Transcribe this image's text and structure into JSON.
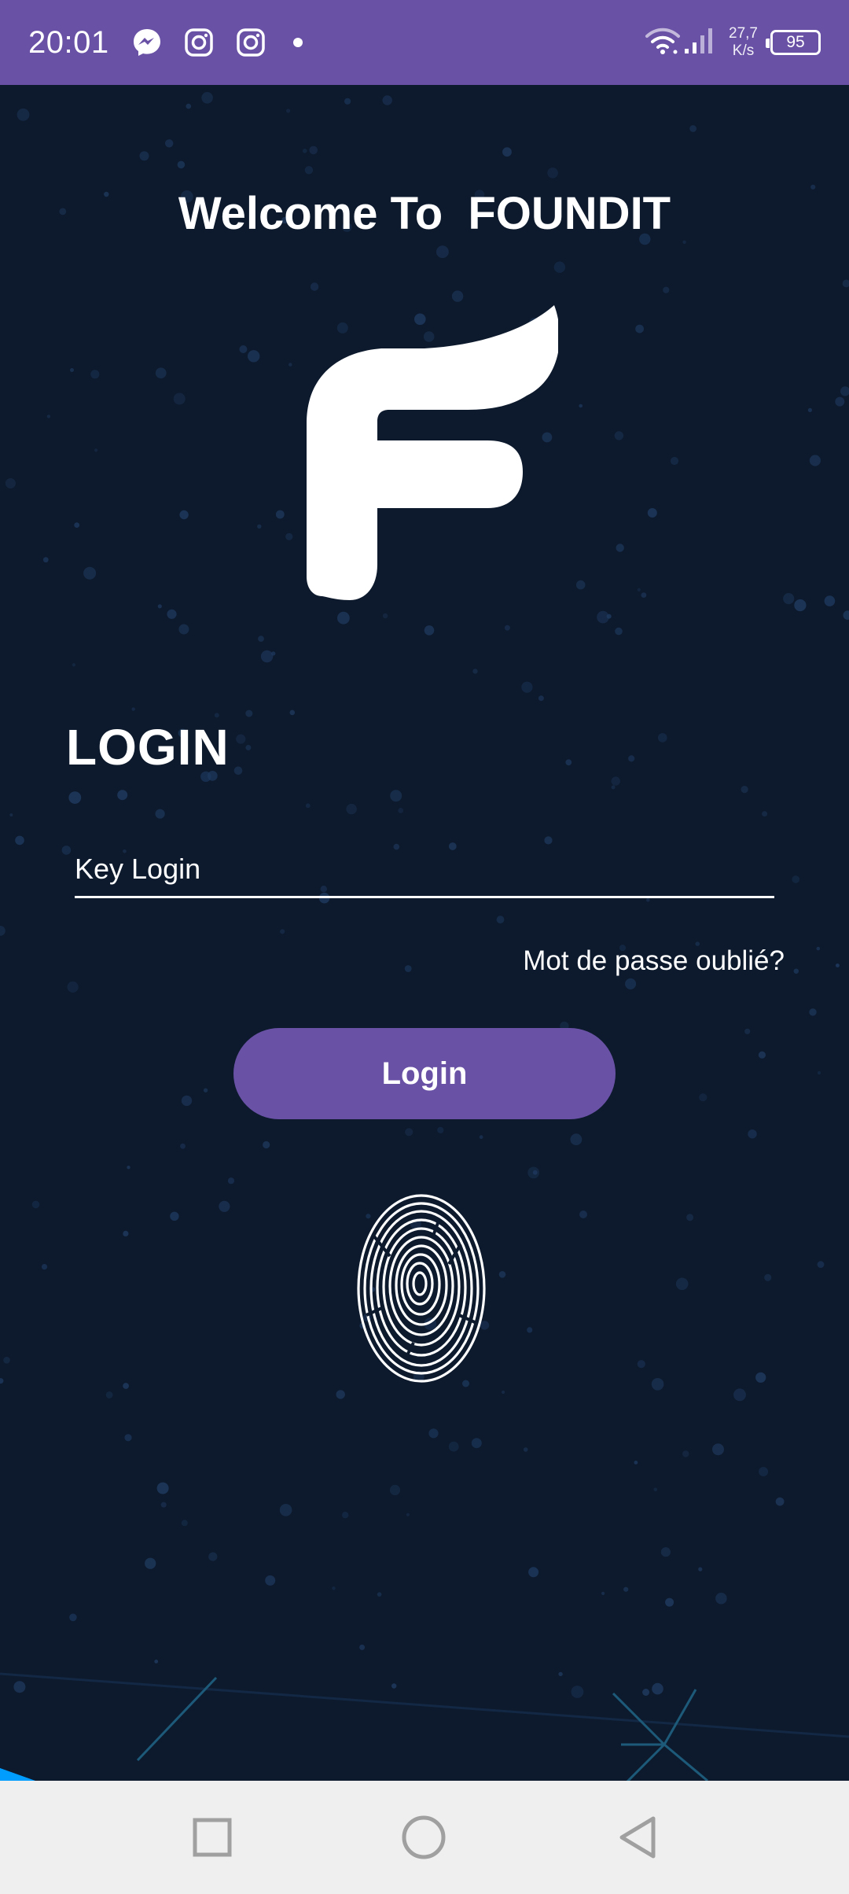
{
  "status_bar": {
    "time": "20:01",
    "left_icons": [
      "messenger-icon",
      "instagram-icon",
      "instagram-icon",
      "notification-dot-icon"
    ],
    "right_icons": [
      "wifi-icon",
      "signal-icon"
    ],
    "net_speed_value": "27,7",
    "net_speed_unit": "K/s",
    "battery": "95",
    "color": "#6951a6"
  },
  "main": {
    "welcome_title": "Welcome To  FOUNDIT",
    "logo_icon": "foundit-logo-icon",
    "login_heading": "LOGIN",
    "key_field": {
      "placeholder": "Key Login",
      "value": ""
    },
    "forgot_password": "Mot de passe oublié?",
    "login_button": "Login",
    "fingerprint_icon": "fingerprint-icon",
    "background_color": "#0d1a2d",
    "accent_color": "#6951a6",
    "decor_color": "#009dff"
  },
  "nav_bar": {
    "buttons": [
      "recent-apps-icon",
      "home-icon",
      "back-icon"
    ]
  }
}
